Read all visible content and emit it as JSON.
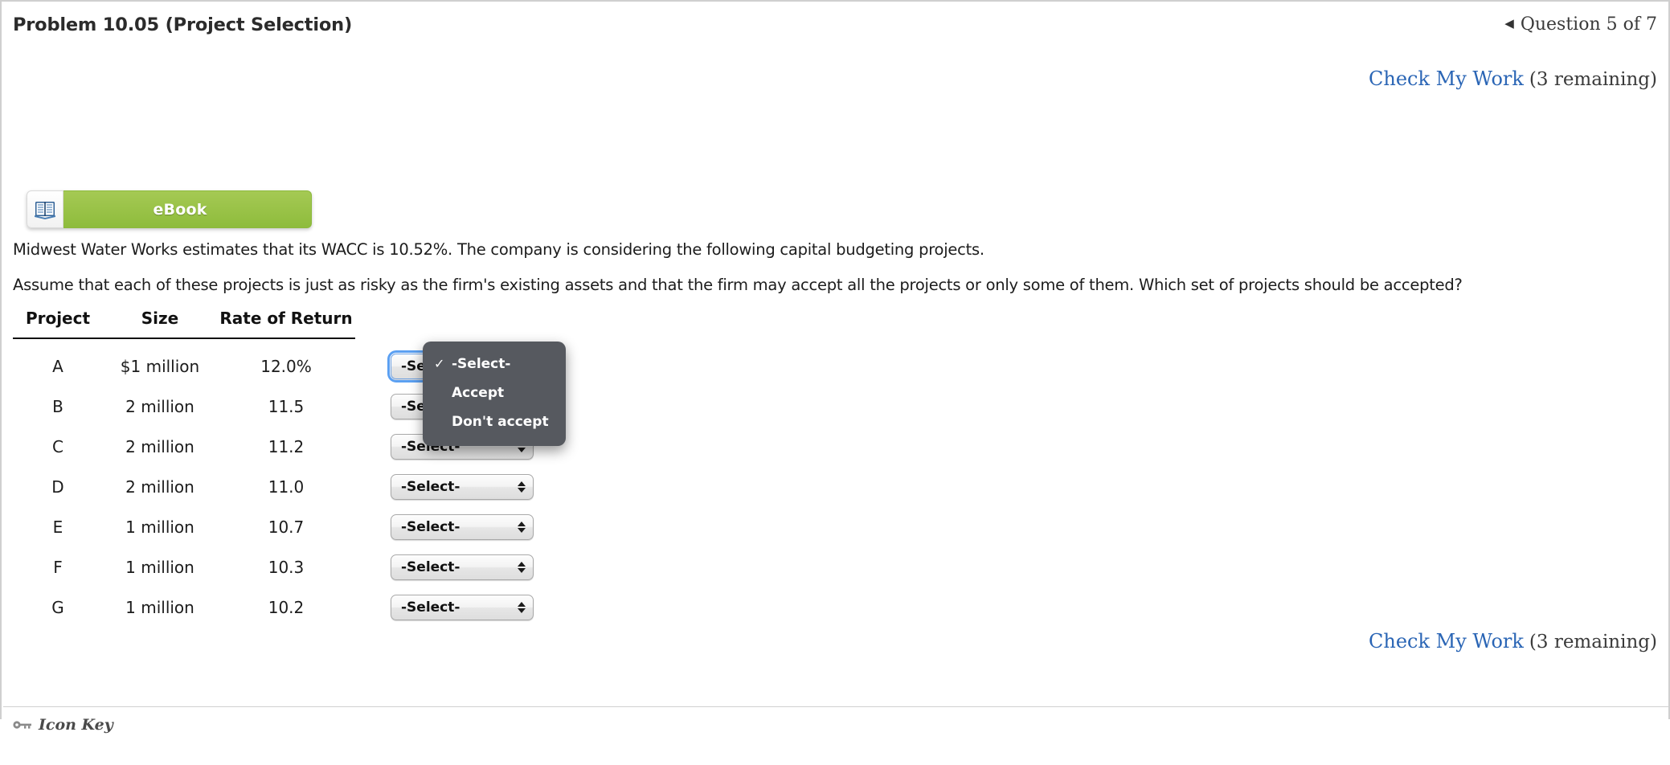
{
  "header": {
    "problem_title": "Problem 10.05 (Project Selection)",
    "nav_arrow_icon": "triangle-left-icon",
    "question_counter": "Question 5 of 7"
  },
  "check_my_work": {
    "link_label": "Check My Work",
    "remaining_label": "(3 remaining)",
    "link_color": "#2a65b5"
  },
  "ebook": {
    "label": "eBook",
    "icon": "open-book-icon",
    "bar_color": "#8ebc3c"
  },
  "problem": {
    "paragraph_1": "Midwest Water Works estimates that its WACC is 10.52%. The company is considering the following capital budgeting projects.",
    "paragraph_2": "Assume that each of these projects is just as risky as the firm's existing assets and that the firm may accept all the projects or only some of them. Which set of projects should be accepted?"
  },
  "table": {
    "columns": [
      "Project",
      "Size",
      "Rate of Return"
    ],
    "rows": [
      {
        "project": "A",
        "size": "$1 million",
        "rate": "12.0%",
        "selection": "-Select-",
        "focused": true
      },
      {
        "project": "B",
        "size": "2 million",
        "rate": "11.5",
        "selection": "-Select-",
        "focused": false
      },
      {
        "project": "C",
        "size": "2 million",
        "rate": "11.2",
        "selection": "-Select-",
        "focused": false
      },
      {
        "project": "D",
        "size": "2 million",
        "rate": "11.0",
        "selection": "-Select-",
        "focused": false
      },
      {
        "project": "E",
        "size": "1 million",
        "rate": "10.7",
        "selection": "-Select-",
        "focused": false
      },
      {
        "project": "F",
        "size": "1 million",
        "rate": "10.3",
        "selection": "-Select-",
        "focused": false
      },
      {
        "project": "G",
        "size": "1 million",
        "rate": "10.2",
        "selection": "-Select-",
        "focused": false
      }
    ]
  },
  "dropdown": {
    "open": true,
    "opened_for_row": "A",
    "selected_index": 0,
    "check_glyph": "✓",
    "background_color": "#56595f",
    "options": [
      {
        "label": "-Select-"
      },
      {
        "label": "Accept"
      },
      {
        "label": "Don't accept"
      }
    ]
  },
  "footer": {
    "icon_key_label": "Icon Key",
    "key_icon": "key-icon"
  }
}
